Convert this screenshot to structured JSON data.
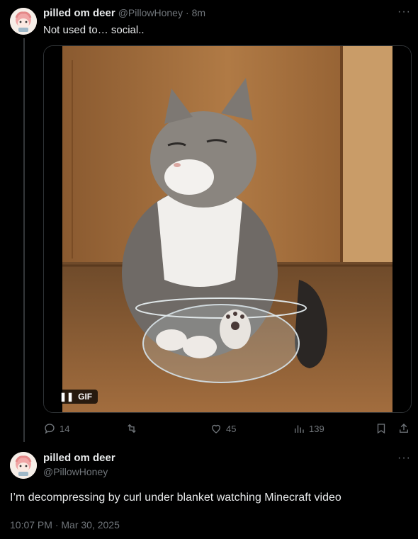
{
  "tweet1": {
    "display_name": "pilled om deer",
    "handle": "@PillowHoney",
    "sep": "·",
    "time": "8m",
    "text": "Not used to… social..",
    "more_label": "···",
    "media": {
      "badge": "GIF",
      "icon": "pause-icon"
    },
    "actions": {
      "replies": "14",
      "retweets": "",
      "likes": "45",
      "views": "139"
    }
  },
  "tweet2": {
    "display_name": "pilled om deer",
    "handle": "@PillowHoney",
    "more_label": "···",
    "text": "I’m decompressing by curl under blanket watching Minecraft video",
    "timestamp": "10:07 PM · Mar 30, 2025"
  },
  "colors": {
    "bg": "#000000",
    "text": "#e7e9ea",
    "muted": "#71767b",
    "border": "#2f3336"
  }
}
